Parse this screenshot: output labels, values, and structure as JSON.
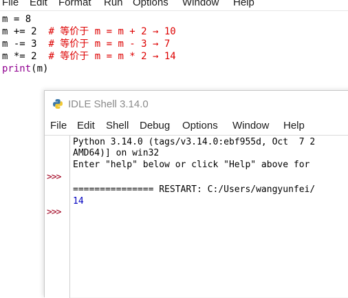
{
  "editor": {
    "menu": [
      "File",
      "Edit",
      "Format",
      "Run",
      "Options",
      "Window",
      "Help"
    ],
    "code": {
      "line1": "m = 8",
      "line2_code": "m += 2  ",
      "line2_comment": "# 等价于 m = m + 2 → 10",
      "line3_code": "m -= 3  ",
      "line3_comment": "# 等价于 m = m - 3 → 7",
      "line4_code": "m *= 2  ",
      "line4_comment": "# 等价于 m = m * 2 → 14",
      "line5_builtin": "print",
      "line5_rest": "(m)"
    }
  },
  "shell": {
    "title": "IDLE Shell 3.14.0",
    "menu": [
      "File",
      "Edit",
      "Shell",
      "Debug",
      "Options",
      "Window",
      "Help"
    ],
    "prompt": ">>>",
    "banner1": "Python 3.14.0 (tags/v3.14.0:ebf955d, Oct  7 2",
    "banner2": "AMD64)] on win32",
    "banner3": "Enter \"help\" below or click \"Help\" above for",
    "restart": "=============== RESTART: C:/Users/wangyunfei/",
    "output": "14"
  },
  "colors": {
    "comment": "#dd0000",
    "builtin": "#900090",
    "prompt": "#a0001e",
    "output": "#0000c0"
  }
}
